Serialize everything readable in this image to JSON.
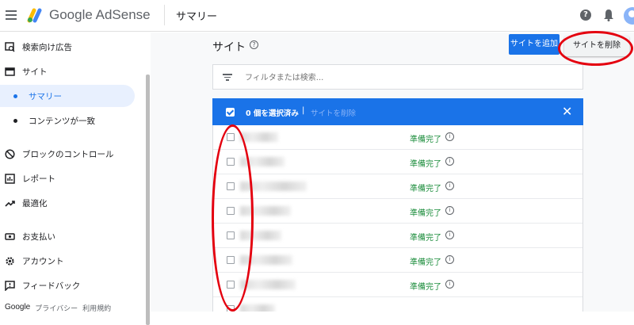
{
  "header": {
    "brand": "Google AdSense",
    "page_title": "サマリー"
  },
  "sidebar": {
    "items": [
      {
        "label": "検索向け広告",
        "icon": "search-ads-icon"
      },
      {
        "label": "サイト",
        "icon": "site-icon"
      },
      {
        "label": "サマリー",
        "icon": "dot",
        "active": true
      },
      {
        "label": "コンテンツが一致",
        "icon": "dot"
      },
      {
        "label": "ブロックのコントロール",
        "icon": "block-icon"
      },
      {
        "label": "レポート",
        "icon": "report-icon"
      },
      {
        "label": "最適化",
        "icon": "trending-icon"
      },
      {
        "label": "お支払い",
        "icon": "payment-icon"
      },
      {
        "label": "アカウント",
        "icon": "gear-icon"
      },
      {
        "label": "フィードバック",
        "icon": "feedback-icon"
      }
    ],
    "footer": {
      "google": "Google",
      "privacy": "プライバシー",
      "terms": "利用規約"
    }
  },
  "main": {
    "section_title": "サイト",
    "add_site_label": "サイトを追加",
    "delete_site_label": "サイトを削除",
    "filter_placeholder": "フィルタまたは検索...",
    "selection": {
      "count_label": "0 個を選択済み",
      "separator": "|",
      "delete_label": "サイトを削除"
    },
    "rows": [
      {
        "status": "準備完了"
      },
      {
        "status": "準備完了"
      },
      {
        "status": "準備完了"
      },
      {
        "status": "準備完了"
      },
      {
        "status": "準備完了"
      },
      {
        "status": "準備完了"
      },
      {
        "status": "準備完了"
      },
      {
        "status": ""
      }
    ]
  },
  "colors": {
    "accent": "#1a73e8",
    "status_ready": "#1e8e3e",
    "annotation": "#e4000f"
  }
}
